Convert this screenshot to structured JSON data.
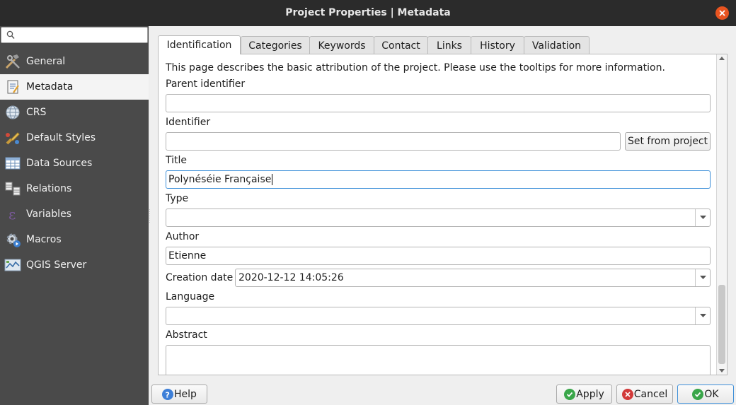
{
  "window": {
    "title": "Project Properties | Metadata"
  },
  "colors": {
    "accent": "#3d8fd8",
    "sidebar_bg": "#4a4a4a",
    "titlebar_bg": "#2b2b2b",
    "close": "#e95420"
  },
  "search": {
    "placeholder": ""
  },
  "sidebar": {
    "items": [
      {
        "label": "General",
        "icon": "hammer-wrench-icon"
      },
      {
        "label": "Metadata",
        "icon": "metadata-document-icon"
      },
      {
        "label": "CRS",
        "icon": "globe-grid-icon"
      },
      {
        "label": "Default Styles",
        "icon": "paint-brush-icon"
      },
      {
        "label": "Data Sources",
        "icon": "table-icon"
      },
      {
        "label": "Relations",
        "icon": "relations-icon"
      },
      {
        "label": "Variables",
        "icon": "epsilon-icon"
      },
      {
        "label": "Macros",
        "icon": "macro-gear-icon"
      },
      {
        "label": "QGIS Server",
        "icon": "server-map-icon"
      }
    ],
    "active": "Metadata"
  },
  "tabs": [
    "Identification",
    "Categories",
    "Keywords",
    "Contact",
    "Links",
    "History",
    "Validation"
  ],
  "active_tab": "Identification",
  "form": {
    "intro": "This page describes the basic attribution of the project. Please use the tooltips for more information.",
    "parent_identifier_label": "Parent identifier",
    "parent_identifier_value": "",
    "identifier_label": "Identifier",
    "identifier_value": "",
    "set_from_project": "Set from project",
    "title_label": "Title",
    "title_value": "Polynéséie Française",
    "type_label": "Type",
    "type_value": "",
    "author_label": "Author",
    "author_value": "Etienne",
    "creation_date_label": "Creation date",
    "creation_date_value": "2020-12-12 14:05:26",
    "language_label": "Language",
    "language_value": "",
    "abstract_label": "Abstract",
    "abstract_value": ""
  },
  "buttons": {
    "help": "Help",
    "apply": "Apply",
    "cancel": "Cancel",
    "ok": "OK"
  }
}
